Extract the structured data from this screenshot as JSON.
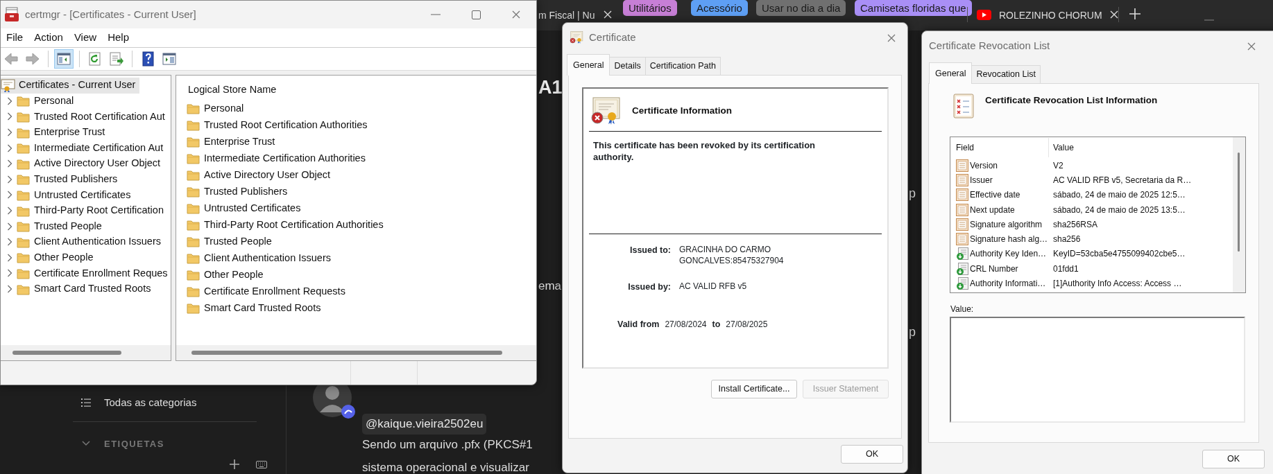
{
  "browser": {
    "tabs": [
      {
        "title": "m Fiscal | Nu",
        "selected": false
      },
      {
        "title": "ROLEZINHO CHORUM",
        "selected": false
      }
    ],
    "tab_groups": [
      {
        "label": "Utilitários",
        "color": "#c77fd6"
      },
      {
        "label": "Acessório",
        "color": "#5e9ff4"
      },
      {
        "label": "Usar no dia a dia",
        "color": "#707070"
      },
      {
        "label": "Camisetas floridas que",
        "color": "#a98ff6"
      }
    ],
    "fragments": [
      "A1",
      "ema",
      "p",
      "p"
    ],
    "sidebar": {
      "items": [
        {
          "label": "Todas as categorias"
        }
      ],
      "section": "ETIQUETAS",
      "section_expanded": true
    },
    "post": {
      "mention": "@kaique.vieira2502eu",
      "lines": [
        "Sendo um arquivo .pfx (PKCS#1",
        "sistema operacional e visualizar"
      ]
    }
  },
  "certmgr": {
    "title": "certmgr - [Certificates - Current User]",
    "menu": [
      "File",
      "Action",
      "View",
      "Help"
    ],
    "toolbar": [
      {
        "kind": "back",
        "disabled": true,
        "pressed": false
      },
      {
        "kind": "forward",
        "disabled": true,
        "pressed": false
      },
      {
        "kind": "tree",
        "disabled": false,
        "pressed": true
      },
      {
        "kind": "refresh",
        "disabled": false,
        "pressed": false
      },
      {
        "kind": "export",
        "disabled": false,
        "pressed": false
      },
      {
        "kind": "help",
        "disabled": false,
        "pressed": false
      },
      {
        "kind": "console",
        "disabled": false,
        "pressed": false
      }
    ],
    "tree": {
      "label": "Certificates - Current User",
      "selected": true,
      "children": [
        {
          "label": "Personal",
          "expanded": false,
          "selected": false
        },
        {
          "label": "Trusted Root Certification Aut",
          "expanded": false,
          "selected": false
        },
        {
          "label": "Enterprise Trust",
          "expanded": false,
          "selected": false
        },
        {
          "label": "Intermediate Certification Aut",
          "expanded": false,
          "selected": false
        },
        {
          "label": "Active Directory User Object",
          "expanded": false,
          "selected": false
        },
        {
          "label": "Trusted Publishers",
          "expanded": false,
          "selected": false
        },
        {
          "label": "Untrusted Certificates",
          "expanded": false,
          "selected": false
        },
        {
          "label": "Third-Party Root Certification",
          "expanded": false,
          "selected": false
        },
        {
          "label": "Trusted People",
          "expanded": false,
          "selected": false
        },
        {
          "label": "Client Authentication Issuers",
          "expanded": false,
          "selected": false
        },
        {
          "label": "Other People",
          "expanded": false,
          "selected": false
        },
        {
          "label": "Certificate Enrollment Reques",
          "expanded": false,
          "selected": false
        },
        {
          "label": "Smart Card Trusted Roots",
          "expanded": false,
          "selected": false
        }
      ]
    },
    "list": {
      "column": "Logical Store Name",
      "rows": [
        "Personal",
        "Trusted Root Certification Authorities",
        "Enterprise Trust",
        "Intermediate Certification Authorities",
        "Active Directory User Object",
        "Trusted Publishers",
        "Untrusted Certificates",
        "Third-Party Root Certification Authorities",
        "Trusted People",
        "Client Authentication Issuers",
        "Other People",
        "Certificate Enrollment Requests",
        "Smart Card Trusted Roots"
      ]
    }
  },
  "certificate_dialog": {
    "title": "Certificate",
    "tabs": [
      {
        "label": "General",
        "selected": true
      },
      {
        "label": "Details",
        "selected": false
      },
      {
        "label": "Certification Path",
        "selected": false
      }
    ],
    "heading": "Certificate Information",
    "revoked": true,
    "status": "This certificate has been revoked by its certification authority.",
    "issued_to": {
      "label": "Issued to:",
      "value": "GRACINHA DO CARMO GONCALVES:85475327904"
    },
    "issued_by": {
      "label": "Issued by:",
      "value": "AC VALID RFB v5"
    },
    "validity": {
      "label": "Valid from",
      "from": "27/08/2024",
      "joiner": "to",
      "to": "27/08/2025"
    },
    "buttons": [
      {
        "label": "Install Certificate...",
        "disabled": false
      },
      {
        "label": "Issuer Statement",
        "disabled": true
      }
    ],
    "ok": "OK"
  },
  "crl_dialog": {
    "title": "Certificate Revocation List",
    "tabs": [
      {
        "label": "General",
        "selected": true
      },
      {
        "label": "Revocation List",
        "selected": false
      }
    ],
    "heading": "Certificate Revocation List Information",
    "table": {
      "columns": [
        "Field",
        "Value"
      ],
      "rows": [
        {
          "kind": "field",
          "field": "Version",
          "value": "V2"
        },
        {
          "kind": "field",
          "field": "Issuer",
          "value": "AC VALID RFB v5, Secretaria da R…"
        },
        {
          "kind": "field",
          "field": "Effective date",
          "value": "sábado, 24 de maio de 2025 12:5…"
        },
        {
          "kind": "field",
          "field": "Next update",
          "value": "sábado, 24 de maio de 2025 13:5…"
        },
        {
          "kind": "field",
          "field": "Signature algorithm",
          "value": "sha256RSA"
        },
        {
          "kind": "field",
          "field": "Signature hash alg…",
          "value": "sha256"
        },
        {
          "kind": "extension",
          "field": "Authority Key Iden…",
          "value": "KeyID=53cba5e4755099402cbe5…"
        },
        {
          "kind": "extension",
          "field": "CRL Number",
          "value": "01fdd1"
        },
        {
          "kind": "extension",
          "field": "Authority Informati…",
          "value": "[1]Authority Info Access: Access …"
        }
      ]
    },
    "value_label": "Value:",
    "ok": "OK"
  }
}
